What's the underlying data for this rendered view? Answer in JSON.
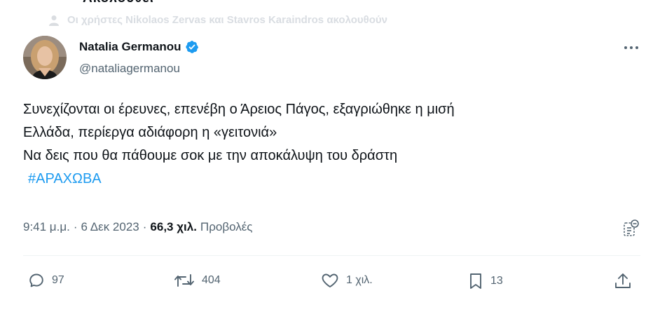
{
  "header": {
    "cutoff_title": "Ακολουθεί",
    "social_context": "Οι χρήστες Nikolaos Zervas και Stavros Karaindros ακολουθούν"
  },
  "author": {
    "name": "Natalia Germanou",
    "handle": "@nataliagermanou",
    "verified": true
  },
  "tweet": {
    "lines": [
      "Συνεχίζονται οι έρευνες, επενέβη ο Άρειος Πάγος, εξαγριώθηκε η μισή",
      "Ελλάδα, περίεργα αδιάφορη η «γειτονιά»",
      "Να δεις που θα πάθουμε σοκ με την αποκάλυψη του δράστη"
    ],
    "hashtag": "#ΑΡΑΧΩΒΑ"
  },
  "meta": {
    "time": "9:41 μ.μ.",
    "separator": "·",
    "date": "6 Δεκ 2023",
    "views_count": "66,3 χιλ.",
    "views_label": "Προβολές"
  },
  "actions": {
    "replies": "97",
    "retweets": "404",
    "likes": "1 χιλ.",
    "bookmarks": "13"
  },
  "colors": {
    "accent": "#1d9bf0",
    "secondary_text": "#536471",
    "primary_text": "#0f1419"
  }
}
